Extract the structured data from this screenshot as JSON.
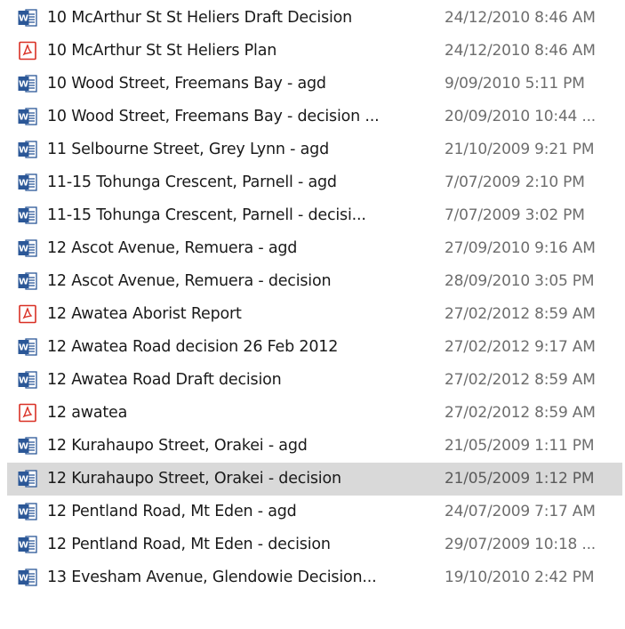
{
  "files": [
    {
      "name": "10 McArthur St St Heliers Draft Decision",
      "date": "24/12/2010 8:46 AM",
      "icon": "word-doc-icon"
    },
    {
      "name": "10 McArthur St St Heliers Plan",
      "date": "24/12/2010 8:46 AM",
      "icon": "pdf-icon"
    },
    {
      "name": "10 Wood Street, Freemans Bay - agd",
      "date": "9/09/2010 5:11 PM",
      "icon": "word-doc-icon"
    },
    {
      "name": "10 Wood Street, Freemans Bay - decision ...",
      "date": "20/09/2010 10:44 ...",
      "icon": "word-doc-icon"
    },
    {
      "name": "11 Selbourne Street, Grey Lynn - agd",
      "date": "21/10/2009 9:21 PM",
      "icon": "word-doc-icon"
    },
    {
      "name": "11-15 Tohunga Crescent, Parnell - agd",
      "date": "7/07/2009 2:10 PM",
      "icon": "word-doc-icon"
    },
    {
      "name": "11-15 Tohunga Crescent, Parnell - decisi...",
      "date": "7/07/2009 3:02 PM",
      "icon": "word-doc-icon"
    },
    {
      "name": "12 Ascot Avenue, Remuera - agd",
      "date": "27/09/2010 9:16 AM",
      "icon": "word-doc-icon"
    },
    {
      "name": "12 Ascot Avenue, Remuera - decision",
      "date": "28/09/2010 3:05 PM",
      "icon": "word-doc-icon"
    },
    {
      "name": "12 Awatea Aborist Report",
      "date": "27/02/2012 8:59 AM",
      "icon": "pdf-icon"
    },
    {
      "name": "12 Awatea Road decision 26 Feb 2012",
      "date": "27/02/2012 9:17 AM",
      "icon": "word-doc-icon"
    },
    {
      "name": "12 Awatea Road Draft decision",
      "date": "27/02/2012 8:59 AM",
      "icon": "word-doc-icon"
    },
    {
      "name": "12 awatea",
      "date": "27/02/2012 8:59 AM",
      "icon": "pdf-icon"
    },
    {
      "name": "12 Kurahaupo Street, Orakei - agd",
      "date": "21/05/2009 1:11 PM",
      "icon": "word-doc-icon"
    },
    {
      "name": "12 Kurahaupo Street, Orakei - decision",
      "date": "21/05/2009 1:12 PM",
      "icon": "word-doc-icon",
      "selected": true
    },
    {
      "name": "12 Pentland Road, Mt Eden - agd",
      "date": "24/07/2009 7:17 AM",
      "icon": "word-doc-icon"
    },
    {
      "name": "12 Pentland Road, Mt Eden - decision",
      "date": "29/07/2009 10:18 ...",
      "icon": "word-doc-icon"
    },
    {
      "name": "13 Evesham Avenue, Glendowie Decision...",
      "date": "19/10/2010 2:42 PM",
      "icon": "word-doc-icon"
    }
  ],
  "colors": {
    "word_blue": "#2b5797",
    "pdf_red": "#d93025",
    "selection_bg": "#d9d9d9",
    "date_gray": "#6d6d6d"
  }
}
